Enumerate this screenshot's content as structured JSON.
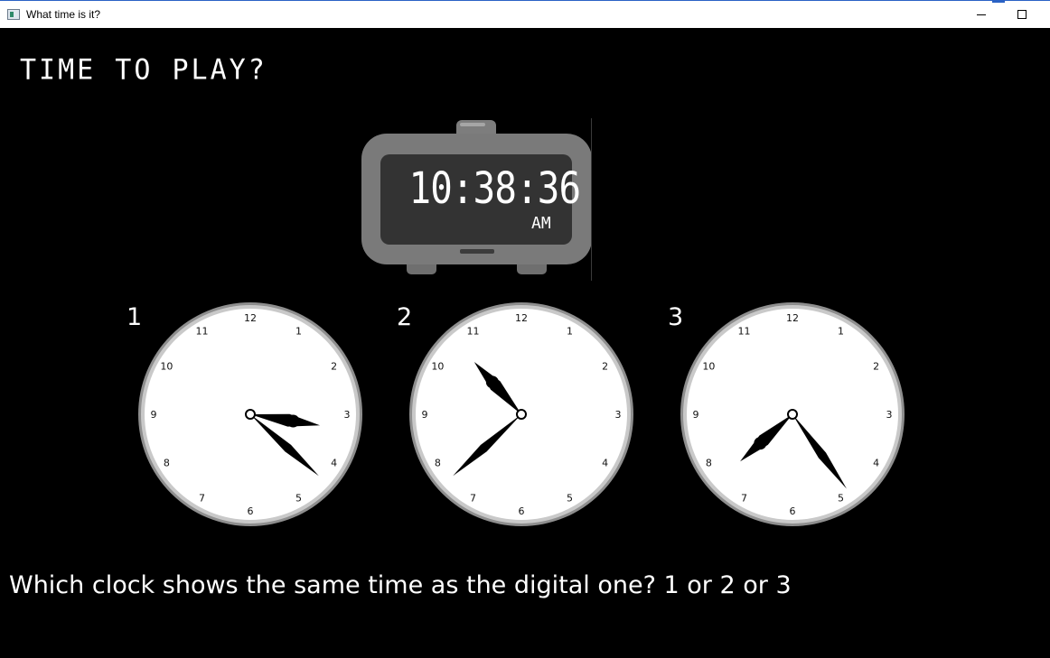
{
  "window": {
    "title": "What time is it?"
  },
  "heading": "TIME TO PLAY?",
  "digital_clock": {
    "time": "10:38:36",
    "ampm": "AM"
  },
  "clocks": [
    {
      "label": "1",
      "hour_hand_to": 3.3,
      "minute_hand_to_min": 22
    },
    {
      "label": "2",
      "hour_hand_to": 10.6,
      "minute_hand_to_min": 38
    },
    {
      "label": "3",
      "hour_hand_to": 7.6,
      "minute_hand_to_min": 24
    }
  ],
  "dial_numbers": [
    "12",
    "1",
    "2",
    "3",
    "4",
    "5",
    "6",
    "7",
    "8",
    "9",
    "10",
    "11"
  ],
  "question": "Which clock shows the same time as the digital one? 1 or 2 or 3",
  "colors": {
    "background": "#000000",
    "clock_face": "#ffffff",
    "clock_rim": "#9a9a9a",
    "alarm_body": "#7a7a7a",
    "alarm_screen": "#333333",
    "text": "#ffffff"
  }
}
